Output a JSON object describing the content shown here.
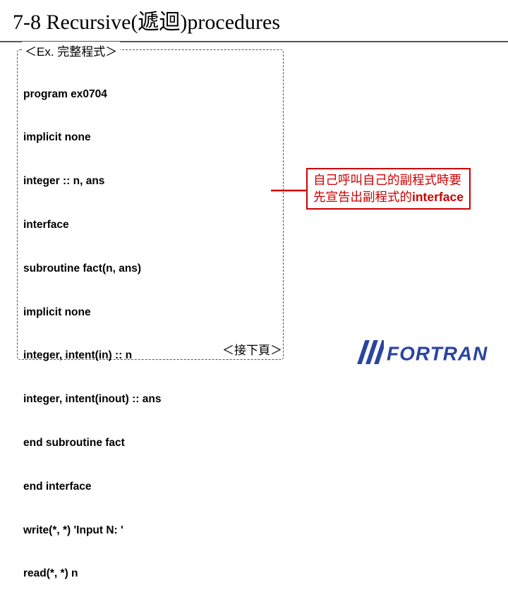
{
  "title": "7-8 Recursive(遞迴)procedures",
  "example_legend_left": "＜Ex.",
  "example_legend_right": "完整程式＞",
  "code": {
    "l0": "program ex0704",
    "l1": "implicit none",
    "l2": "integer :: n, ans",
    "l3": "interface",
    "l4": "subroutine fact(n, ans)",
    "l5": "implicit none",
    "l6": "integer, intent(in) :: n",
    "l7": "integer, intent(inout) :: ans",
    "l8": "end subroutine fact",
    "l9": "end interface",
    "l10": "write(*, *) 'Input N: '",
    "l11": "read(*, *) n"
  },
  "callout": {
    "line1": "自己呼叫自己的副程式時要",
    "line2_pre": "先宣告出副程式的",
    "line2_iface": "interface"
  },
  "next_page": "＜接下頁＞",
  "logo_text": "FORTRAN"
}
